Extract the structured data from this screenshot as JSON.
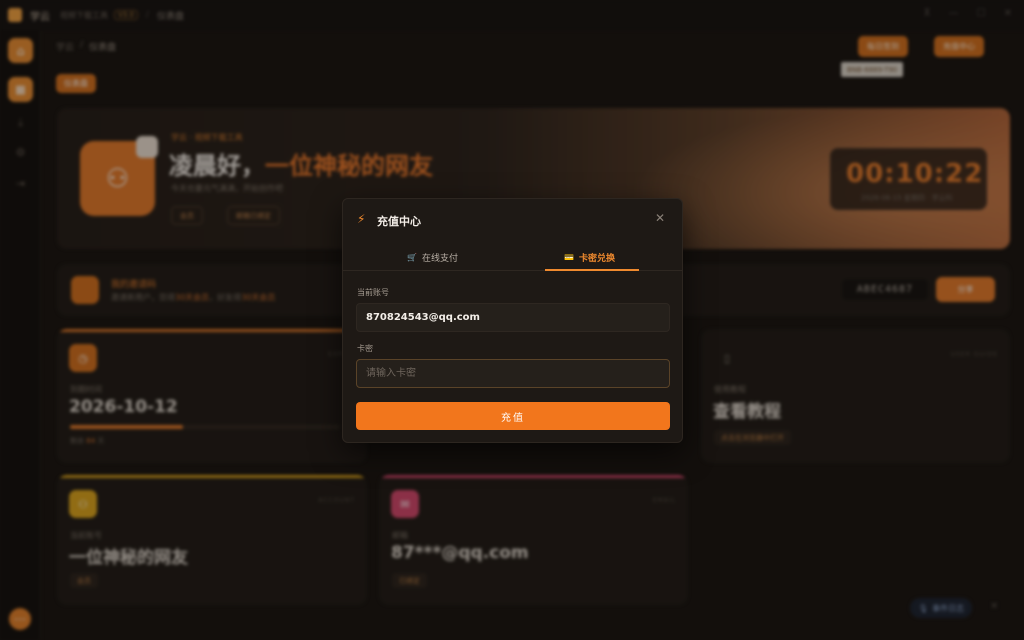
{
  "titlebar": {
    "app_name": "学云",
    "app_subtitle": "视频下载工具",
    "version": "V3.0",
    "separator": "/",
    "page": "仪表盘",
    "controls": [
      "⊼",
      "—",
      "☐",
      "✕"
    ]
  },
  "breadcrumb": {
    "root": "学云",
    "sep": "/",
    "current": "仪表盘"
  },
  "header_buttons": {
    "daily_checkin": "每日签到",
    "recharge_center": "充值中心"
  },
  "serial_badge": "BNB-6889-T90",
  "page_tab": "仪表盘",
  "hero": {
    "subtitle": "学云 · 视频下载工具",
    "greeting_prefix": "凌晨好，",
    "greeting_name": "一位神秘的网友",
    "description": "今天也要元气满满，开始创作吧",
    "chip_member": "会员",
    "chip_bound": "邮箱已绑定",
    "clock": "00:10:22",
    "clock_sub": "2026-06-15 星期四 · 学云科"
  },
  "invite": {
    "title": "我的邀请码",
    "description_prefix": "邀请新用户，您得",
    "days1": "30天会员",
    "description_mid": "，好友得",
    "days2": "30天会员",
    "code": "ABEC4687",
    "share_label": "分享"
  },
  "cards": {
    "expiry": {
      "tag": "EXPIRY",
      "label": "到期时间",
      "value": "2026-10-12",
      "remain_prefix": "剩余",
      "remain_days": "84",
      "remain_suffix": "天",
      "progress": 0.42
    },
    "tutorial": {
      "tag": "USER GUIDE",
      "label": "使用教程",
      "value": "查看教程",
      "chip": "点击在浏览器中打开"
    },
    "account": {
      "tag": "ACCOUNT",
      "label": "当前账号",
      "value": "一位神秘的网友",
      "chip": "会员"
    },
    "email": {
      "tag": "EMAIL",
      "label": "邮箱",
      "value": "87***@qq.com",
      "chip": "已绑定"
    }
  },
  "event_log": {
    "label": "事件日志",
    "close": "✕"
  },
  "modal": {
    "title_icon": "⚡",
    "title": "充值中心",
    "close": "✕",
    "tabs": [
      {
        "icon": "🛒",
        "label": "在线支付"
      },
      {
        "icon": "💳",
        "label": "卡密兑换"
      }
    ],
    "account_label": "当前账号",
    "account_value": "870824543@qq.com",
    "card_label": "卡密",
    "card_placeholder": "请输入卡密",
    "submit": "充值"
  },
  "colors": {
    "accent": "#f2761c",
    "background": "#171310",
    "modal": "#1e1915"
  }
}
